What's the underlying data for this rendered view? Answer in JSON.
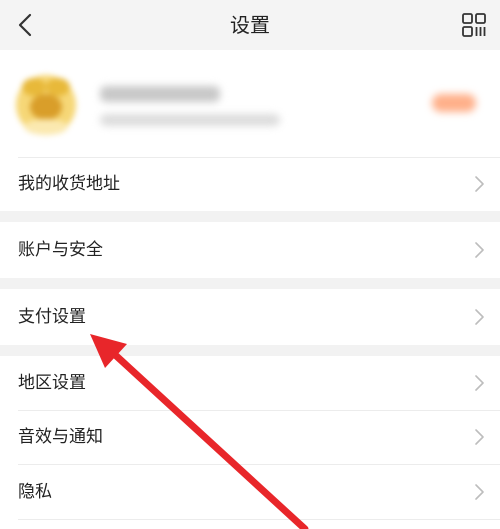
{
  "navbar": {
    "title": "设置",
    "back_icon": "chevron-left-icon",
    "right_icon": "qr-code-icon"
  },
  "profile": {
    "avatar_icon": "blurred-avatar-image",
    "name_blurred": true,
    "info_blurred": true,
    "badge_color": "#ffb08a"
  },
  "settings": {
    "items": [
      {
        "label": "我的收货地址"
      },
      {
        "label": "账户与安全"
      },
      {
        "label": "支付设置"
      },
      {
        "label": "地区设置"
      },
      {
        "label": "音效与通知"
      },
      {
        "label": "隐私"
      }
    ]
  },
  "annotation": {
    "arrow_color": "#e8262a",
    "points_to": "支付设置"
  }
}
